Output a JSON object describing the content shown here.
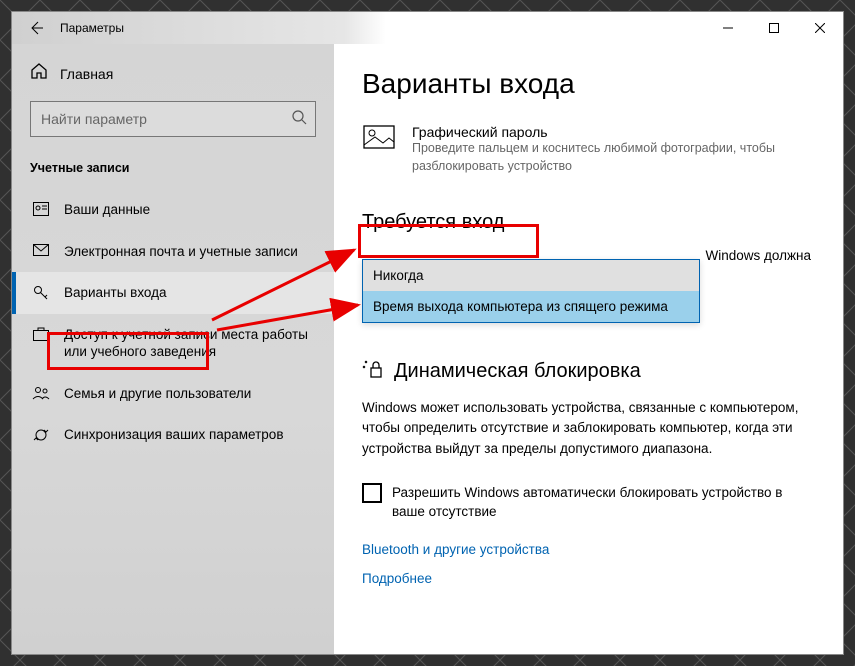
{
  "window": {
    "title": "Параметры"
  },
  "sidebar": {
    "home": "Главная",
    "search_placeholder": "Найти параметр",
    "section": "Учетные записи",
    "items": [
      {
        "label": "Ваши данные"
      },
      {
        "label": "Электронная почта и учетные записи"
      },
      {
        "label": "Варианты входа"
      },
      {
        "label": "Доступ к учетной записи места работы или учебного заведения"
      },
      {
        "label": "Семья и другие пользователи"
      },
      {
        "label": "Синхронизация ваших параметров"
      }
    ]
  },
  "content": {
    "page_title": "Варианты входа",
    "picture_password": {
      "title": "Графический пароль",
      "desc": "Проведите пальцем и коснитесь любимой фотографии, чтобы разблокировать устройство"
    },
    "require_signin": {
      "heading": "Требуется вход",
      "partial_desc": "Windows должна",
      "options": [
        "Никогда",
        "Время выхода компьютера из спящего режима"
      ],
      "selected": "Никогда"
    },
    "dynamic_lock": {
      "heading": "Динамическая блокировка",
      "desc": "Windows может использовать устройства, связанные с компьютером, чтобы определить отсутствие и заблокировать компьютер, когда эти устройства выйдут за пределы допустимого диапазона.",
      "checkbox": "Разрешить Windows автоматически блокировать устройство в ваше отсутствие"
    },
    "links": {
      "bluetooth": "Bluetooth и другие устройства",
      "more": "Подробнее"
    }
  }
}
